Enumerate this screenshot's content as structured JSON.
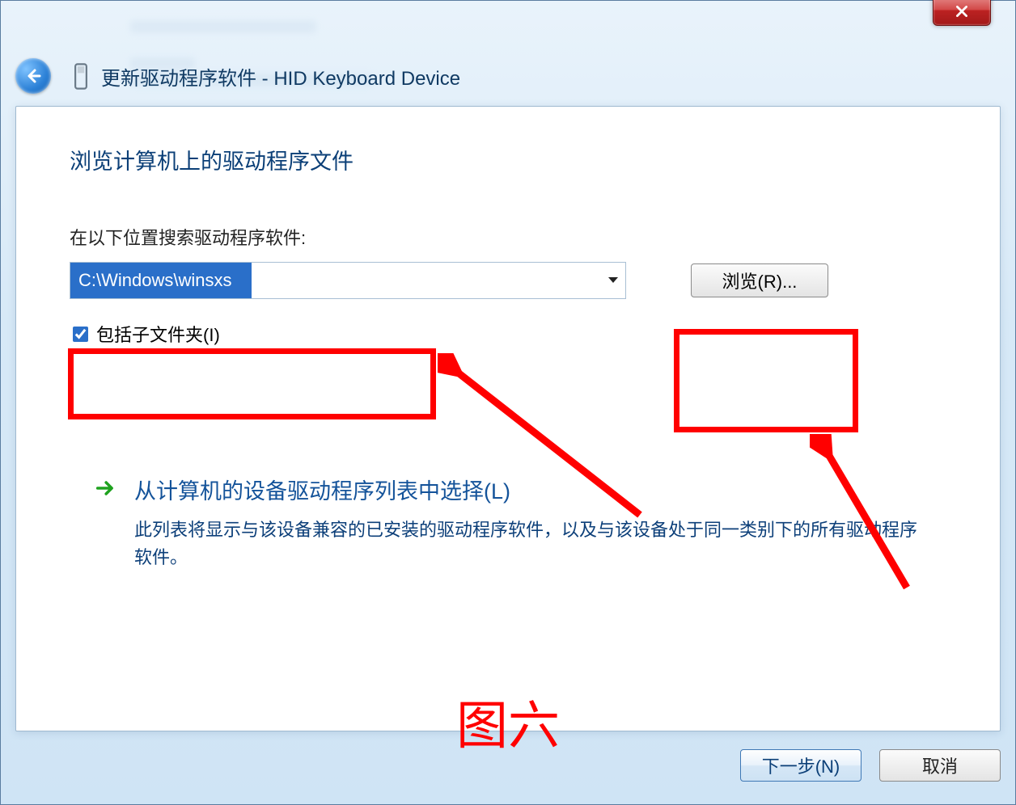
{
  "window": {
    "title_prefix": "更新驱动程序软件",
    "title_separator": " - ",
    "title_device": "HID Keyboard Device",
    "close_tooltip": "关闭"
  },
  "main": {
    "heading": "浏览计算机上的驱动程序文件",
    "search_label": "在以下位置搜索驱动程序软件:",
    "path_value": "C:\\Windows\\winsxs",
    "browse_label": "浏览(R)...",
    "include_subfolders_label": "包括子文件夹(I)",
    "include_subfolders_checked": true
  },
  "command_link": {
    "title": "从计算机的设备驱动程序列表中选择(L)",
    "description": "此列表将显示与该设备兼容的已安装的驱动程序软件，以及与该设备处于同一类别下的所有驱动程序软件。"
  },
  "footer": {
    "next_label": "下一步(N)",
    "cancel_label": "取消"
  },
  "annotations": {
    "caption": "图六"
  },
  "colors": {
    "accent": "#ff0000",
    "link": "#14539a"
  }
}
